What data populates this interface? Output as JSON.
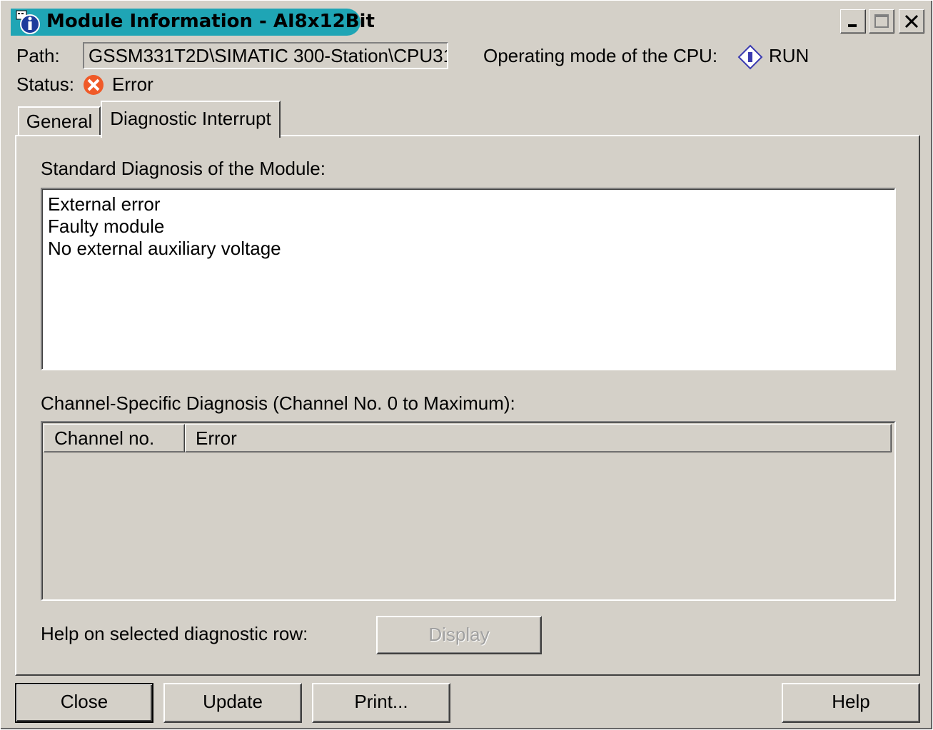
{
  "window": {
    "title": "Module Information - AI8x12Bit",
    "app_icon": "info-icon",
    "controls": {
      "minimize": "_",
      "maximize": "□",
      "close": "✕"
    }
  },
  "header": {
    "path_label": "Path:",
    "path_value": "GSSM331T2D\\SIMATIC 300-Station\\CPU31",
    "cpu_mode_label": "Operating mode of the  CPU:",
    "cpu_mode_icon": "run-diamond-icon",
    "cpu_mode_value": "RUN",
    "status_label": "Status:",
    "status_icon": "error-x-icon",
    "status_value": "Error",
    "status_color": "#f05a28"
  },
  "tabs": [
    {
      "label": "General",
      "selected": false
    },
    {
      "label": "Diagnostic Interrupt",
      "selected": true
    }
  ],
  "standard_diagnosis": {
    "label": "Standard Diagnosis of the Module:",
    "items": [
      "External error",
      "Faulty module",
      "No external auxiliary voltage"
    ]
  },
  "channel_diagnosis": {
    "label": "Channel-Specific Diagnosis (Channel No. 0 to Maximum):",
    "columns": [
      "Channel no.",
      "Error"
    ],
    "rows": []
  },
  "help_row": {
    "label": "Help on selected diagnostic row:",
    "display_button": "Display",
    "display_enabled": false
  },
  "buttons": {
    "close": "Close",
    "update": "Update",
    "print": "Print...",
    "help": "Help"
  },
  "colors": {
    "title_accent": "#1fa5b5",
    "window_bg": "#d4d0c8",
    "run_icon": "#3a3ab0"
  }
}
